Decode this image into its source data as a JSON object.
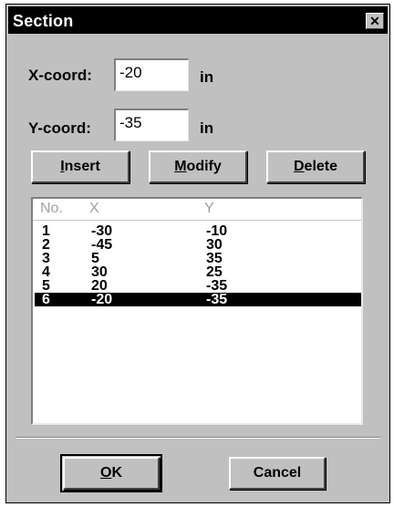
{
  "window": {
    "title": "Section",
    "close_glyph": "✕"
  },
  "x_coord": {
    "label": "X-coord:",
    "value": "-20",
    "unit": "in"
  },
  "y_coord": {
    "label": "Y-coord:",
    "value": "-35",
    "unit": "in"
  },
  "buttons": {
    "insert": {
      "mnemonic": "I",
      "rest": "nsert"
    },
    "modify": {
      "mnemonic": "M",
      "rest": "odify"
    },
    "delete": {
      "mnemonic": "D",
      "rest": "elete"
    },
    "ok": {
      "mnemonic": "O",
      "rest": "K"
    },
    "cancel": {
      "mnemonic": "",
      "rest": "Cancel"
    }
  },
  "list": {
    "headers": {
      "no": "No.",
      "x": "X",
      "y": "Y"
    },
    "rows": [
      {
        "no": "1",
        "x": "-30",
        "y": "-10"
      },
      {
        "no": "2",
        "x": "-45",
        "y": "30"
      },
      {
        "no": "3",
        "x": "5",
        "y": "35"
      },
      {
        "no": "4",
        "x": "30",
        "y": "25"
      },
      {
        "no": "5",
        "x": "20",
        "y": "-35"
      },
      {
        "no": "6",
        "x": "-20",
        "y": "-35"
      }
    ],
    "selected_index": 5
  }
}
